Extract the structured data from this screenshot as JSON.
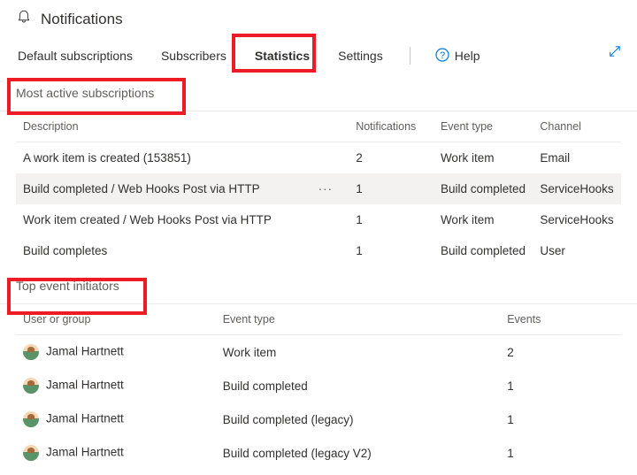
{
  "page": {
    "title": "Notifications"
  },
  "tabs": {
    "items": [
      "Default subscriptions",
      "Subscribers",
      "Statistics",
      "Settings"
    ],
    "active_index": 2,
    "help_label": "Help"
  },
  "sections": {
    "active_subs": {
      "heading": "Most active subscriptions",
      "columns": [
        "Description",
        "Notifications",
        "Event type",
        "Channel"
      ],
      "rows": [
        {
          "description": "A work item is created (153851)",
          "notifications": "2",
          "event_type": "Work item",
          "channel": "Email",
          "hover": false,
          "more": false
        },
        {
          "description": "Build completed / Web Hooks Post via HTTP",
          "notifications": "1",
          "event_type": "Build completed",
          "channel": "ServiceHooks",
          "hover": true,
          "more": true
        },
        {
          "description": "Work item created / Web Hooks Post via HTTP",
          "notifications": "1",
          "event_type": "Work item",
          "channel": "ServiceHooks",
          "hover": false,
          "more": false
        },
        {
          "description": "Build completes",
          "notifications": "1",
          "event_type": "Build completed",
          "channel": "User",
          "hover": false,
          "more": false
        }
      ]
    },
    "top_initiators": {
      "heading": "Top event initiators",
      "columns": [
        "User or group",
        "Event type",
        "Events"
      ],
      "rows": [
        {
          "user": "Jamal Hartnett",
          "event_type": "Work item",
          "events": "2"
        },
        {
          "user": "Jamal Hartnett",
          "event_type": "Build completed",
          "events": "1"
        },
        {
          "user": "Jamal Hartnett",
          "event_type": "Build completed (legacy)",
          "events": "1"
        },
        {
          "user": "Jamal Hartnett",
          "event_type": "Build completed (legacy V2)",
          "events": "1"
        }
      ]
    }
  },
  "glyphs": {
    "ellipsis": "···"
  }
}
